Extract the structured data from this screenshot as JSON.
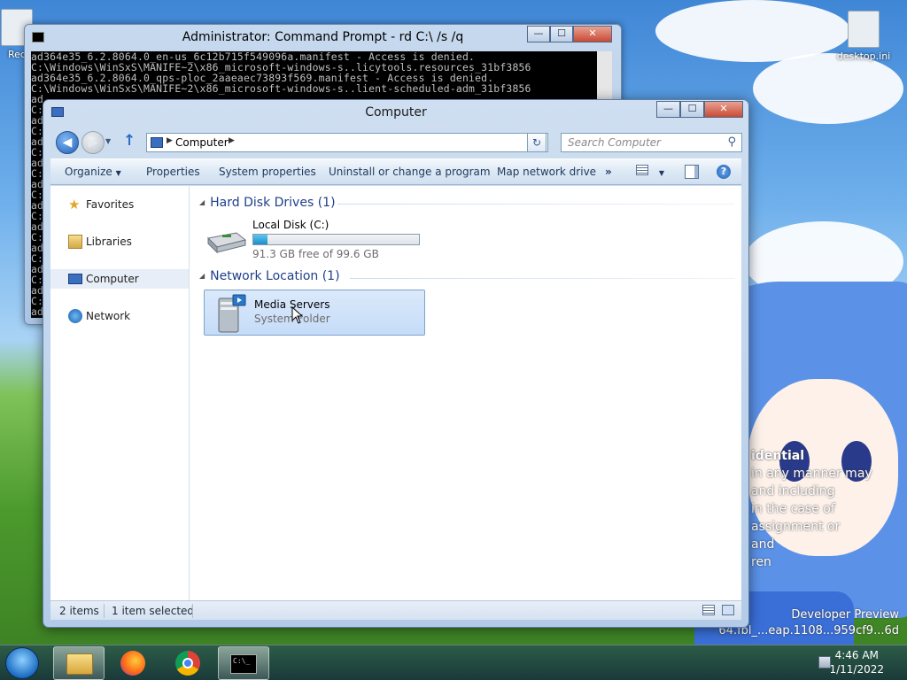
{
  "desktop": {
    "icons": [
      {
        "label": "Rec"
      },
      {
        "label": "desktop.ini"
      }
    ],
    "eula_lines": [
      "idential",
      "in any manner may",
      "and including",
      "in the case of",
      "assignment or",
      "and",
      "ren"
    ],
    "watermark_lines": [
      "Developer Preview",
      "64.fbl_...eap.1108...959cf9...6d"
    ]
  },
  "cmd": {
    "title": "Administrator: Command Prompt - rd  C:\\ /s /q",
    "lines": [
      "ad364e35_6.2.8064.0_en-us_6c12b715f549096a.manifest - Access is denied.",
      "C:\\Windows\\WinSxS\\MANIFE~2\\x86_microsoft-windows-s..licytools.resources_31bf3856",
      "ad364e35_6.2.8064.0_qps-ploc_2aaeaec73893f569.manifest - Access is denied.",
      "C:\\Windows\\WinSxS\\MANIFE~2\\x86_microsoft-windows-s..lient-scheduled-adm_31bf3856",
      "ad",
      "C:",
      "ad",
      "C:",
      "ad",
      "C:",
      "ad",
      "C:",
      "ad",
      "C:",
      "ad",
      "C:",
      "ad",
      "C:",
      "ad",
      "C:",
      "ad",
      "C:",
      "ad",
      "C:",
      "ad",
      "C:",
      "ad"
    ],
    "buttons": {
      "minimize": "—",
      "maximize": "☐",
      "close": "✕"
    }
  },
  "explorer": {
    "title": "Computer",
    "buttons": {
      "minimize": "—",
      "maximize": "☐",
      "close": "✕"
    },
    "address": {
      "segment": "Computer"
    },
    "search": {
      "placeholder": "Search Computer"
    },
    "toolbar": {
      "organize": "Organize",
      "properties": "Properties",
      "system_properties": "System properties",
      "uninstall": "Uninstall or change a program",
      "map_drive": "Map network drive",
      "more": "»"
    },
    "nav": {
      "favorites": "Favorites",
      "libraries": "Libraries",
      "computer": "Computer",
      "network": "Network"
    },
    "groups": {
      "hard_disk": "Hard Disk Drives (1)",
      "network_location": "Network Location (1)"
    },
    "drive": {
      "name": "Local Disk (C:)",
      "free_text": "91.3 GB free of 99.6 GB",
      "used_fraction": 0.083
    },
    "network_item": {
      "name": "Media Servers",
      "type": "System Folder"
    },
    "status": {
      "items": "2 items",
      "selected": "1 item selected"
    }
  },
  "taskbar": {
    "time": "4:46 AM",
    "date": "1/11/2022"
  },
  "colors": {
    "accent": "#1e3f8a",
    "selection": "#c5dcf8",
    "drive_fill": "#1a8dcc"
  }
}
